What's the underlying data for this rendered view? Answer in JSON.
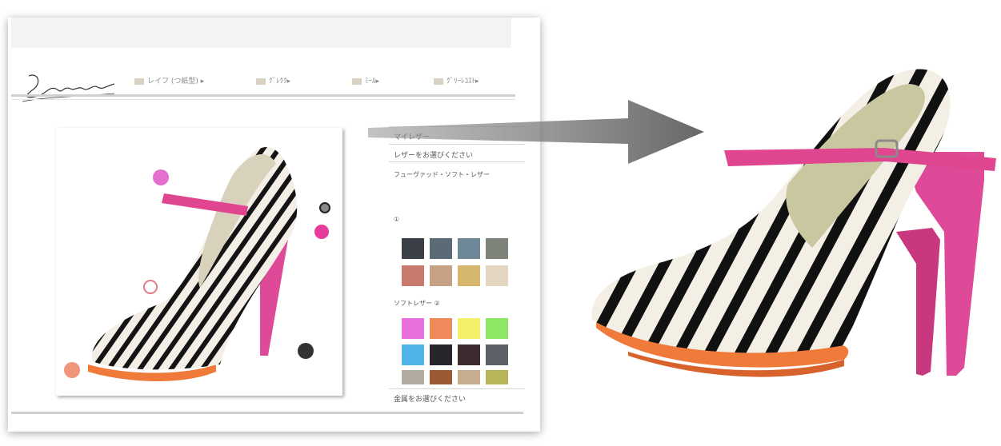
{
  "site": {
    "logo_text": "Jacqueline Ray"
  },
  "nav": {
    "items": [
      {
        "label": "レイフ (つ紙型) ▸"
      },
      {
        "label": "ｸﾞﾚｸｸ▸"
      },
      {
        "label": "ﾐｰﾙ▸"
      },
      {
        "label": "ｸﾞﾘｰﾚｺｽﾄ▸"
      }
    ]
  },
  "panel": {
    "my_leather": "マイレザー",
    "choose_leather": "レザーをお選びください",
    "section1_title": "フューヴァッド・ソフト・レザー",
    "section1_number": "①",
    "section2_title": "ソフトレザー ②",
    "footer_prompt": "金属をお選びください",
    "palette1": [
      "#3a3f48",
      "#5b6b76",
      "#6f8898",
      "#7e837a",
      "#c97a6e",
      "#c7a183",
      "#d6b56d",
      "#e3d5bf"
    ],
    "palette2": [
      "#e66fd9",
      "#f08a5a",
      "#f3f06a",
      "#8fe865",
      "#4db4e8",
      "#25252b",
      "#3c2c2f",
      "#5d6066",
      "#b3aba2",
      "#9b5a34",
      "#c6ad8e",
      "#b8b45a"
    ]
  },
  "shoe_colors": {
    "strap": "#e0468f",
    "heel": "#de4a98",
    "sole": "#f07a3a",
    "lining": "#c9c7a0"
  },
  "markers": {
    "colors": [
      "#e46fcd",
      "#e63b9b",
      "#e47a8a",
      "#e35fb0",
      "#333333",
      "#f0967a"
    ]
  }
}
